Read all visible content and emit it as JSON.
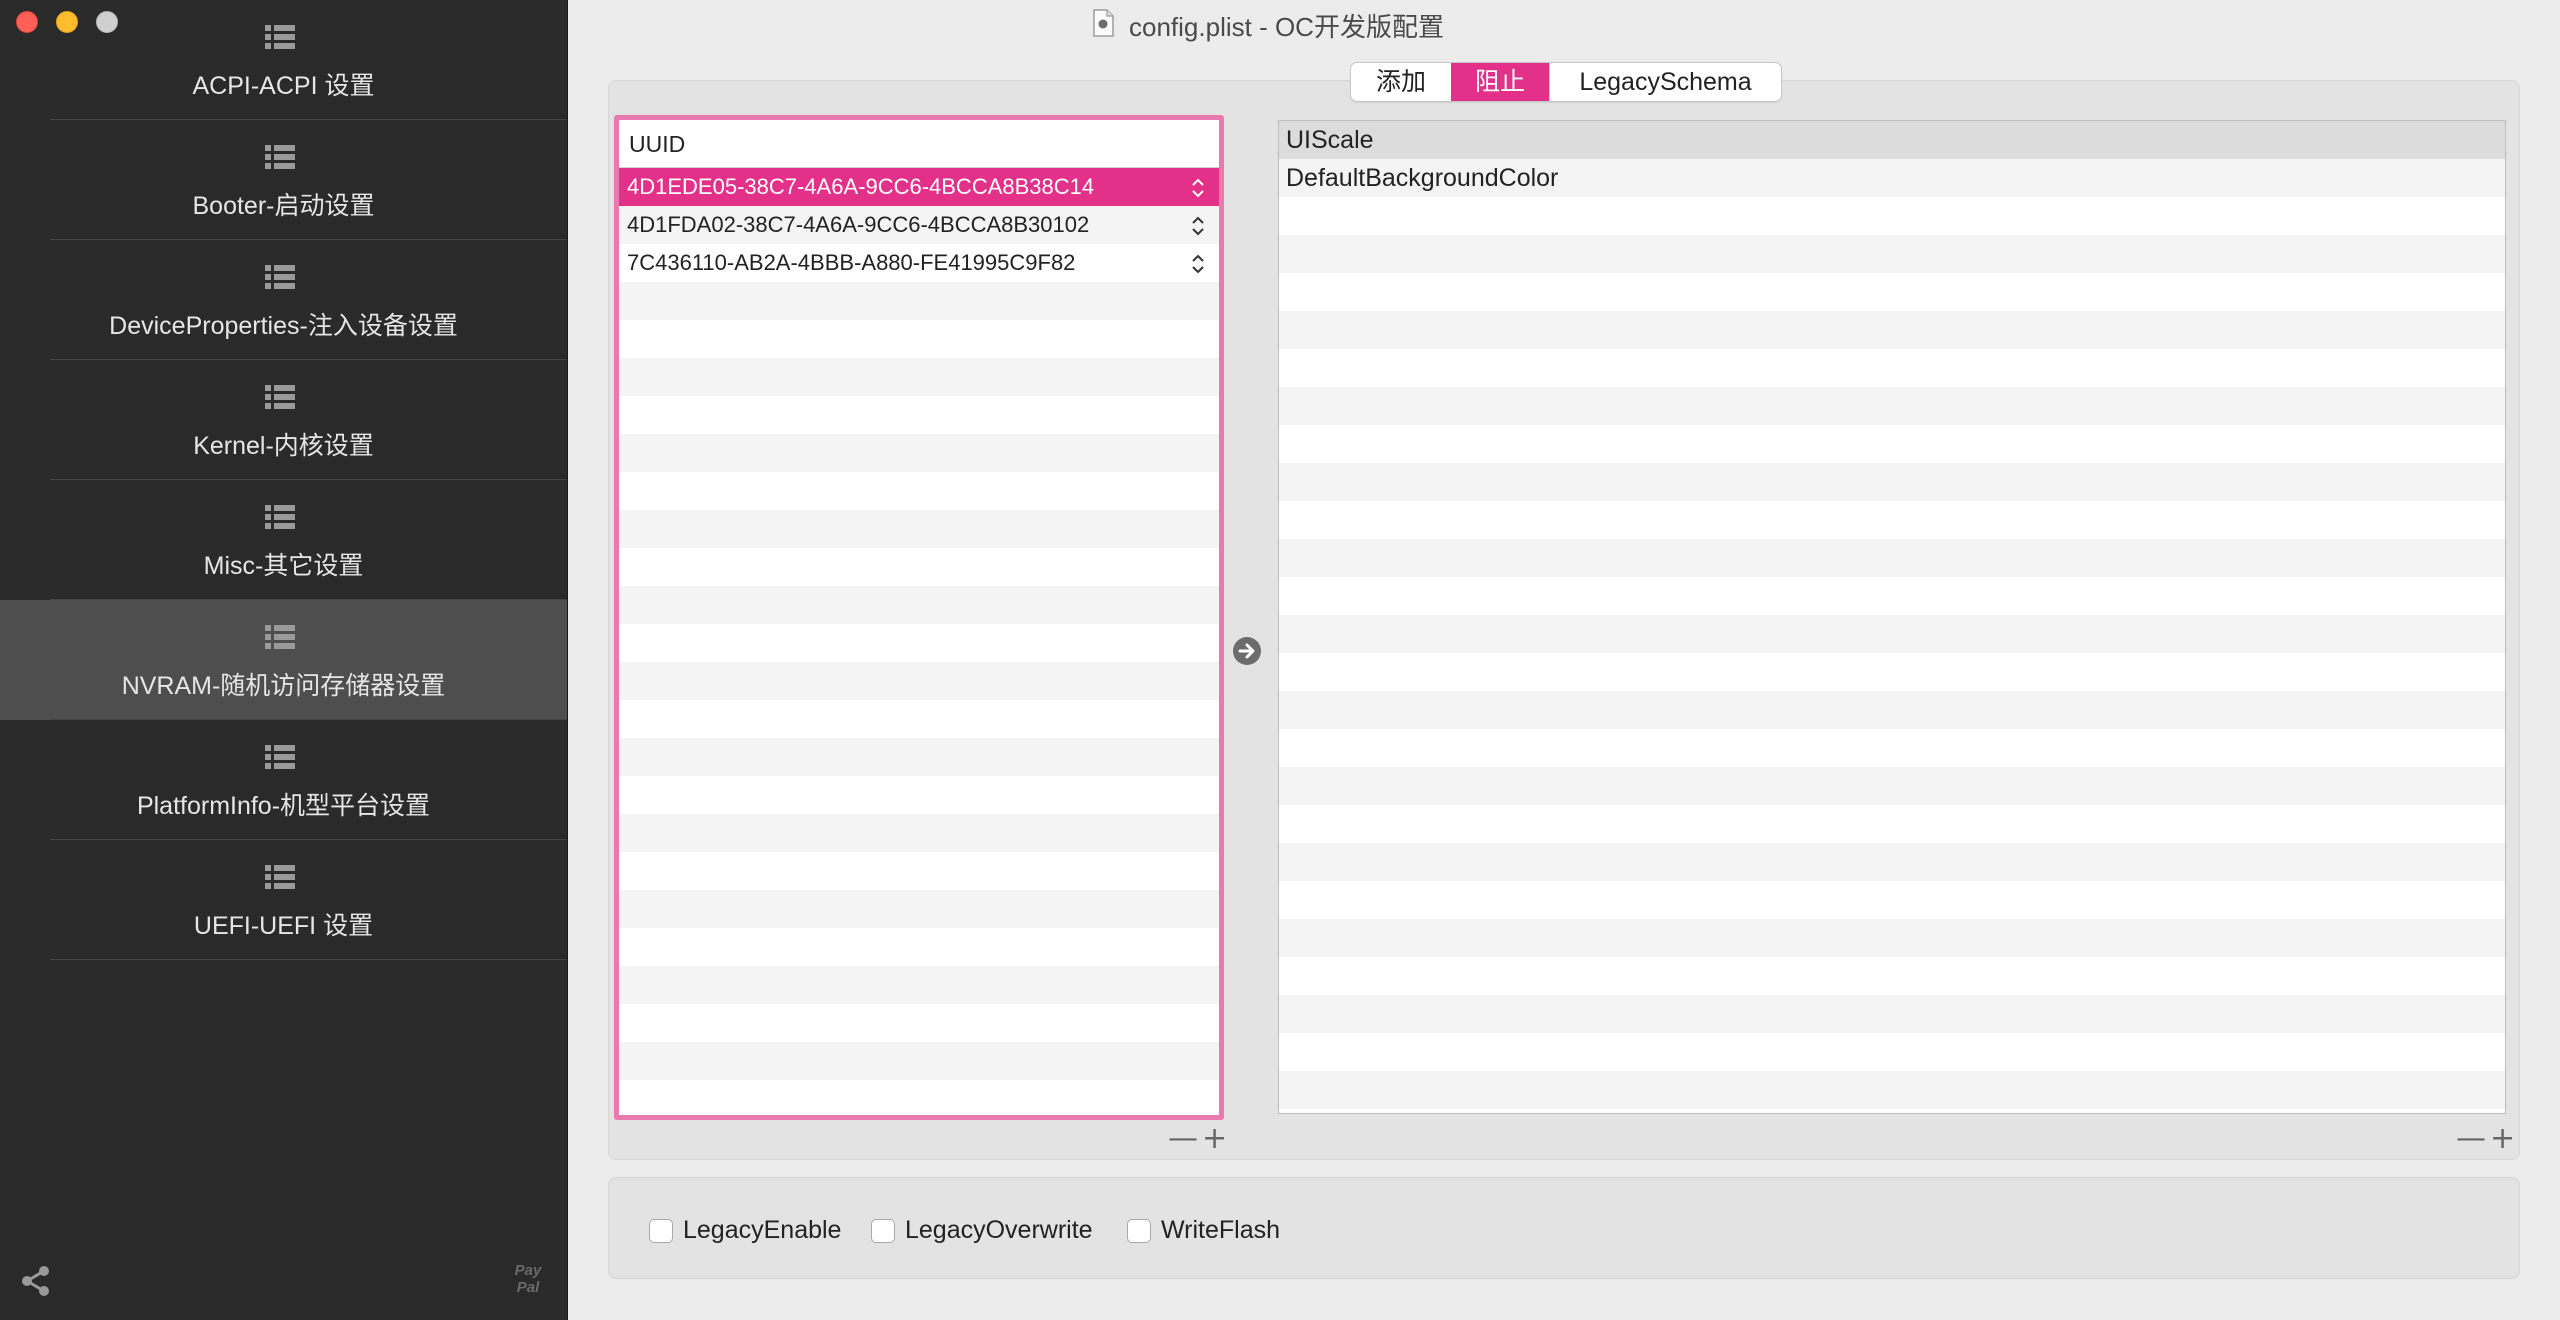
{
  "window": {
    "title": "config.plist - OC开发版配置"
  },
  "sidebar": {
    "items": [
      {
        "label": "ACPI-ACPI 设置",
        "icon": "list-icon"
      },
      {
        "label": "Booter-启动设置",
        "icon": "list-icon"
      },
      {
        "label": "DeviceProperties-注入设备设置",
        "icon": "list-icon"
      },
      {
        "label": "Kernel-内核设置",
        "icon": "list-icon"
      },
      {
        "label": "Misc-其它设置",
        "icon": "list-icon"
      },
      {
        "label": "NVRAM-随机访问存储器设置",
        "icon": "list-icon",
        "active": true
      },
      {
        "label": "PlatformInfo-机型平台设置",
        "icon": "list-icon"
      },
      {
        "label": "UEFI-UEFI 设置",
        "icon": "list-icon"
      }
    ],
    "footer": {
      "share_icon": "share-icon",
      "paypal_line1": "Pay",
      "paypal_line2": "Pal"
    }
  },
  "tabs": {
    "add_label": "添加",
    "block_label": "阻止",
    "legacy_schema_label": "LegacySchema",
    "selected": "阻止"
  },
  "uuid_table": {
    "header": "UUID",
    "rows": [
      "4D1EDE05-38C7-4A6A-9CC6-4BCCA8B38C14",
      "4D1FDA02-38C7-4A6A-9CC6-4BCCA8B30102",
      "7C436110-AB2A-4BBB-A880-FE41995C9F82"
    ],
    "selected_index": 0
  },
  "props_table": {
    "rows": [
      "UIScale",
      "DefaultBackgroundColor"
    ]
  },
  "controls": {
    "minus": "—",
    "plus": "+"
  },
  "options": {
    "legacy_enable": {
      "label": "LegacyEnable",
      "checked": false
    },
    "legacy_overwrite": {
      "label": "LegacyOverwrite",
      "checked": false
    },
    "write_flash": {
      "label": "WriteFlash",
      "checked": false
    }
  },
  "colors": {
    "accent": "#e3318a",
    "table_border": "#e97aaf",
    "sidebar_bg": "#2b2a2a",
    "sidebar_active": "#4f4e4e"
  }
}
